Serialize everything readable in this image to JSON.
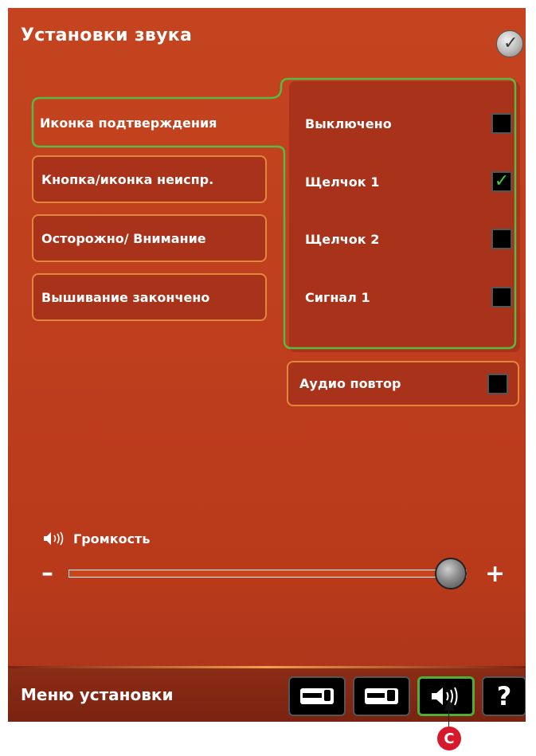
{
  "window": {
    "title": "Установки звука",
    "ok_icon": "checkmark-icon"
  },
  "categories": [
    {
      "label": "Иконка подтверждения",
      "active": true
    },
    {
      "label": "Кнопка/иконка неиспр.",
      "active": false
    },
    {
      "label": "Осторожно/ Внимание",
      "active": false
    },
    {
      "label": "Вышивание закончено",
      "active": false
    }
  ],
  "sounds": [
    {
      "label": "Выключено",
      "checked": false
    },
    {
      "label": "Щелчок 1",
      "checked": true
    },
    {
      "label": "Щелчок 2",
      "checked": false
    },
    {
      "label": "Сигнал 1",
      "checked": false
    }
  ],
  "audio_repeat": {
    "label": "Аудио повтор",
    "checked": false
  },
  "volume": {
    "label": "Громкость",
    "icon": "speaker-icon",
    "minus": "–",
    "plus": "+",
    "level": 0.96
  },
  "bottom_bar": {
    "title": "Меню установки",
    "buttons": [
      {
        "name": "machine-settings",
        "icon": "sewing-machine-icon"
      },
      {
        "name": "machine-settings-2",
        "icon": "sewing-machine-icon"
      },
      {
        "name": "sound-settings",
        "icon": "speaker-icon",
        "active": true
      },
      {
        "name": "help",
        "icon": "question-icon",
        "label": "?"
      }
    ]
  },
  "callout": {
    "label": "C"
  },
  "colors": {
    "panel": "#c2411e",
    "button_border": "#e2873a",
    "active_outline": "#5ab844",
    "checkmark": "#3fcf3f"
  }
}
